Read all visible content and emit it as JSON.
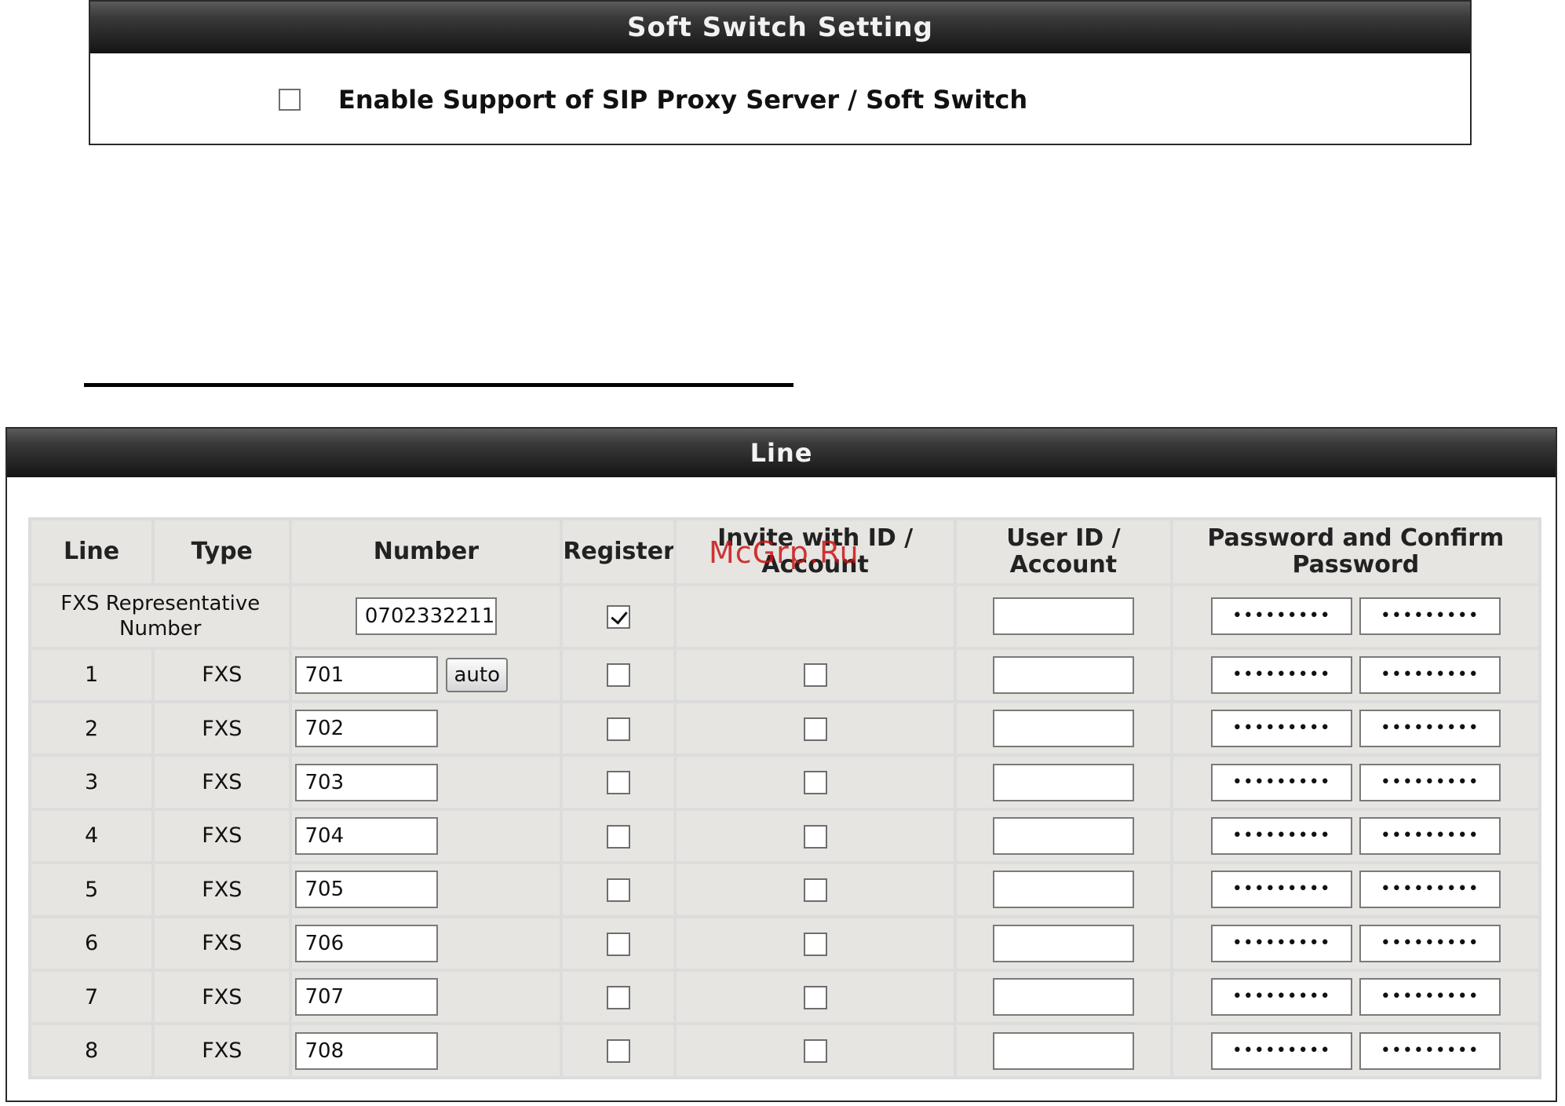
{
  "soft_switch": {
    "title": "Soft Switch Setting",
    "enable_label": "Enable Support of SIP Proxy Server / Soft Switch",
    "enabled": false
  },
  "line_panel": {
    "title": "Line",
    "headers": {
      "line": "Line",
      "type": "Type",
      "number": "Number",
      "register": "Register",
      "invite": "Invite with ID / Account",
      "userid": "User ID / Account",
      "password": "Password and Confirm Password"
    },
    "representative": {
      "label": "FXS Representative Number",
      "number": "0702332211",
      "register_checked": true,
      "user_id": "",
      "password": "•••••••••",
      "confirm": "•••••••••"
    },
    "auto_button": "auto",
    "rows": [
      {
        "line": "1",
        "type": "FXS",
        "number": "701",
        "password": "•••••••••",
        "confirm": "•••••••••"
      },
      {
        "line": "2",
        "type": "FXS",
        "number": "702",
        "password": "•••••••••",
        "confirm": "•••••••••"
      },
      {
        "line": "3",
        "type": "FXS",
        "number": "703",
        "password": "•••••••••",
        "confirm": "•••••••••"
      },
      {
        "line": "4",
        "type": "FXS",
        "number": "704",
        "password": "•••••••••",
        "confirm": "•••••••••"
      },
      {
        "line": "5",
        "type": "FXS",
        "number": "705",
        "password": "•••••••••",
        "confirm": "•••••••••"
      },
      {
        "line": "6",
        "type": "FXS",
        "number": "706",
        "password": "•••••••••",
        "confirm": "•••••••••"
      },
      {
        "line": "7",
        "type": "FXS",
        "number": "707",
        "password": "•••••••••",
        "confirm": "•••••••••"
      },
      {
        "line": "8",
        "type": "FXS",
        "number": "708",
        "password": "•••••••••",
        "confirm": "•••••••••"
      }
    ]
  },
  "watermark": "McGrp.Ru"
}
